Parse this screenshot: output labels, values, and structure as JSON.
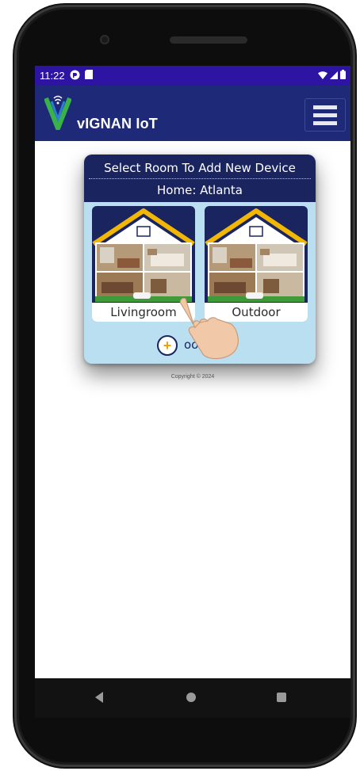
{
  "status_bar": {
    "time": "11:22",
    "icons": [
      "app-notification-icon",
      "sim-card-icon",
      "wifi-icon",
      "signal-icon",
      "battery-icon"
    ]
  },
  "app_bar": {
    "title": "vIGNAN IoT",
    "logo": "vignan-v-logo",
    "menu_icon": "hamburger-menu-icon",
    "background_color": "#1e2a78"
  },
  "dialog": {
    "title": "Select Room To Add New Device",
    "subtitle": "Home: Atlanta",
    "rooms": [
      {
        "label": "Livingroom",
        "icon": "house-room-icon"
      },
      {
        "label": "Outdoor",
        "icon": "house-room-icon"
      }
    ],
    "add_icon": "add-circle-icon",
    "add_label": "oom",
    "colors": {
      "header": "#1a2560",
      "body": "#b9dff0",
      "roof": "#f2b705",
      "add_plus": "#f2a100"
    }
  },
  "copyright": "Copyright © 2024",
  "nav_bar": {
    "icons": [
      "back-icon",
      "home-icon",
      "recents-icon"
    ]
  }
}
